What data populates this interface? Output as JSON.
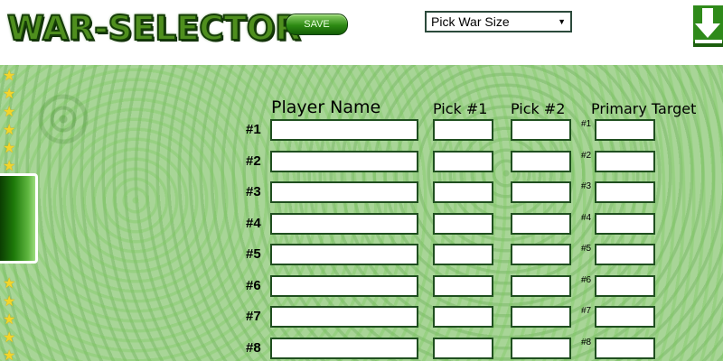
{
  "header": {
    "logo_text": "WAR-SELECTOR",
    "save_label": "SAVE",
    "war_size_selected": "Pick War Size"
  },
  "table": {
    "headers": {
      "player": "Player Name",
      "pick1": "Pick #1",
      "pick2": "Pick #2",
      "target": "Primary Target"
    },
    "rows": [
      {
        "label": "#1",
        "target_label": "#1"
      },
      {
        "label": "#2",
        "target_label": "#2"
      },
      {
        "label": "#3",
        "target_label": "#3"
      },
      {
        "label": "#4",
        "target_label": "#4"
      },
      {
        "label": "#5",
        "target_label": "#5"
      },
      {
        "label": "#6",
        "target_label": "#6"
      },
      {
        "label": "#7",
        "target_label": "#7"
      },
      {
        "label": "#8",
        "target_label": "#8"
      }
    ]
  },
  "colors": {
    "accent": "#2d8a13",
    "background": "#a8d597",
    "star": "#f3d52b"
  },
  "icons": [
    "download-arrow-icon",
    "star-icon",
    "caret-down-icon"
  ]
}
